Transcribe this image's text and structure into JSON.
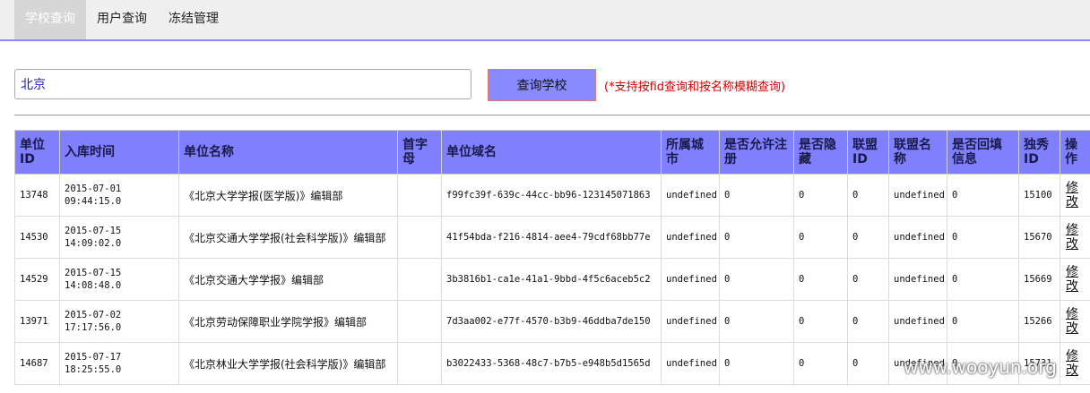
{
  "nav": {
    "tabs": [
      {
        "label": "学校查询",
        "active": true
      },
      {
        "label": "用户查询",
        "active": false
      },
      {
        "label": "冻结管理",
        "active": false
      }
    ]
  },
  "search": {
    "value": "北京",
    "button_label": "查询学校",
    "hint": "(*支持按fid查询和按名称模糊查询)"
  },
  "table": {
    "headers": [
      "单位ID",
      "入库时间",
      "单位名称",
      "首字母",
      "单位域名",
      "所属城市",
      "是否允许注册",
      "是否隐藏",
      "联盟ID",
      "联盟名称",
      "是否回填信息",
      "独秀ID",
      "操作"
    ],
    "rows": [
      {
        "id": "13748",
        "time_date": "2015-07-01",
        "time_clock": "09:44:15.0",
        "name": "《北京大学学报(医学版)》编辑部",
        "initial": "",
        "domain": "f99fc39f-639c-44cc-bb96-123145071863",
        "city": "undefined",
        "allow_register": "0",
        "hidden": "0",
        "alliance_id": "0",
        "alliance_name": "undefined",
        "backfill": "0",
        "duxiu_id": "15100",
        "action": "修改"
      },
      {
        "id": "14530",
        "time_date": "2015-07-15",
        "time_clock": "14:09:02.0",
        "name": "《北京交通大学学报(社会科学版)》编辑部",
        "initial": "",
        "domain": "41f54bda-f216-4814-aee4-79cdf68bb77e",
        "city": "undefined",
        "allow_register": "0",
        "hidden": "0",
        "alliance_id": "0",
        "alliance_name": "undefined",
        "backfill": "0",
        "duxiu_id": "15670",
        "action": "修改"
      },
      {
        "id": "14529",
        "time_date": "2015-07-15",
        "time_clock": "14:08:48.0",
        "name": "《北京交通大学学报》编辑部",
        "initial": "",
        "domain": "3b3816b1-ca1e-41a1-9bbd-4f5c6aceb5c2",
        "city": "undefined",
        "allow_register": "0",
        "hidden": "0",
        "alliance_id": "0",
        "alliance_name": "undefined",
        "backfill": "0",
        "duxiu_id": "15669",
        "action": "修改"
      },
      {
        "id": "13971",
        "time_date": "2015-07-02",
        "time_clock": "17:17:56.0",
        "name": "《北京劳动保障职业学院学报》编辑部",
        "initial": "",
        "domain": "7d3aa002-e77f-4570-b3b9-46ddba7de150",
        "city": "undefined",
        "allow_register": "0",
        "hidden": "0",
        "alliance_id": "0",
        "alliance_name": "undefined",
        "backfill": "0",
        "duxiu_id": "15266",
        "action": "修改"
      },
      {
        "id": "14687",
        "time_date": "2015-07-17",
        "time_clock": "18:25:55.0",
        "name": "《北京林业大学学报(社会科学版)》编辑部",
        "initial": "",
        "domain": "b3022433-5368-48c7-b7b5-e948b5d1565d",
        "city": "undefined",
        "allow_register": "0",
        "hidden": "0",
        "alliance_id": "0",
        "alliance_name": "undefined",
        "backfill": "0",
        "duxiu_id": "15731",
        "action": "修改"
      }
    ]
  },
  "watermark": "www.wooyun.org",
  "colors": {
    "header_bg": "#8080ff",
    "button_bg": "#8a8aff",
    "hint": "#d00000",
    "nav_active_bg": "#d6d6d6"
  }
}
